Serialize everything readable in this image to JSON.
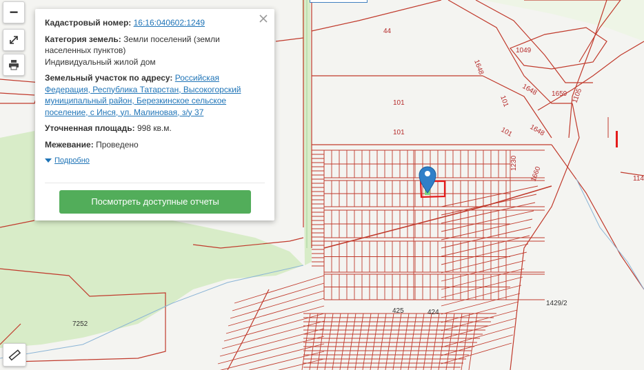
{
  "controls": {
    "zoom_out_glyph": "−"
  },
  "popup": {
    "cadastral_label": "Кадастровый номер:",
    "cadastral_value": "16:16:040602:1249",
    "category_label": "Категория земель:",
    "category_value": "Земли поселений (земли населенных пунктов)",
    "permitted_use": "Индивидуальный жилой дом",
    "address_label": "Земельный участок по адресу:",
    "address_value": "Российская Федерация, Республика Татарстан, Высокогорский муниципальный район, Березкинское сельское поселение, с Инся, ул. Малиновая, з/у 37",
    "area_label": "Уточненная площадь:",
    "area_value": "998 кв.м.",
    "survey_label": "Межевание:",
    "survey_value": "Проведено",
    "more_link": "Подробно",
    "reports_button": "Посмотреть доступные отчеты"
  },
  "map_labels": {
    "l44": "44",
    "l1049": "1049",
    "l1648a": "1648",
    "l1648b": "1648",
    "l1648c": "1648",
    "l1659": "1659",
    "l1105": "1105",
    "l101a": "101",
    "l101b": "101",
    "l101c": "101",
    "l101d": "101",
    "l1230": "1230",
    "l1660": "1660",
    "l114": "114",
    "l1429": "1429/2",
    "l425": "425",
    "l424": "424",
    "l7252": "7252"
  },
  "colors": {
    "parcel_line": "#c0392b",
    "highlight": "#e41b1b",
    "marker": "#2f7fc8",
    "green_area": "#d8ecc8",
    "button": "#52ad5a",
    "link": "#1f74b7"
  },
  "icons": [
    "zoom-out-icon",
    "fullscreen-icon",
    "print-icon",
    "ruler-icon",
    "close-icon",
    "triangle-down-icon",
    "map-marker-icon"
  ]
}
